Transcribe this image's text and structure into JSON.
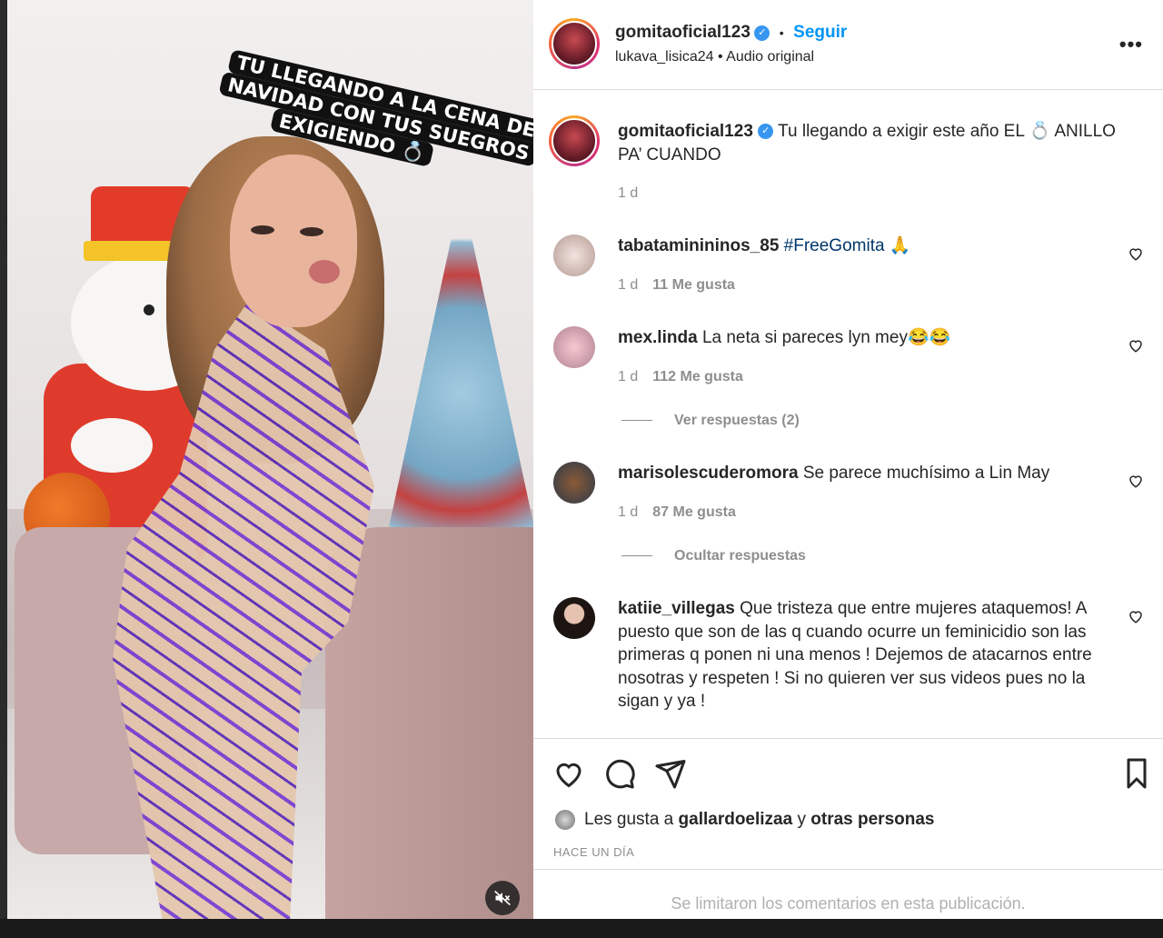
{
  "media": {
    "sticker_lines": [
      "TU LLEGANDO A LA CENA DE",
      "NAVIDAD CON TUS SUEGROS",
      "EXIGIENDO 💍"
    ],
    "mute_icon": "speaker-muted-icon"
  },
  "header": {
    "username": "gomitaoficial123",
    "verified_icon": "verified-badge-icon",
    "separator": "•",
    "follow_label": "Seguir",
    "audio_user": "lukava_lisica24",
    "audio_sep": "•",
    "audio_label": "Audio original",
    "more_label": "•••"
  },
  "caption": {
    "username": "gomitaoficial123",
    "text": "Tu llegando a exigir este año EL 💍 ANILLO PA’ CUANDO",
    "time": "1 d"
  },
  "comments": [
    {
      "username": "tabataminininos_85",
      "text": "#FreeGomita 🙏",
      "time": "1 d",
      "likes": "11 Me gusta"
    },
    {
      "username": "mex.linda",
      "text": "La neta si pareces lyn mey😂😂",
      "time": "1 d",
      "likes": "112 Me gusta",
      "replies": "Ver respuestas (2)"
    },
    {
      "username": "marisolescuderomora",
      "text": "Se parece muchísimo a Lin May",
      "time": "1 d",
      "likes": "87 Me gusta",
      "replies": "Ocultar respuestas"
    },
    {
      "username": "katiie_villegas",
      "text": "Que tristeza que entre mujeres ataquemos! A puesto que son de las q cuando ocurre un feminicidio son las primeras q ponen ni una menos ! Dejemos de atacarnos entre nosotras y respeten ! Si no quieren ver sus videos pues no la sigan y ya !"
    }
  ],
  "actions": {
    "icons": [
      "heart-icon",
      "comment-icon",
      "share-icon",
      "bookmark-icon"
    ],
    "likes_prefix": "Les gusta a",
    "likes_user": "gallardoelizaa",
    "likes_and": "y",
    "likes_others": "otras personas",
    "time_ago": "HACE UN DÍA"
  },
  "footer": {
    "limited_text": "Se limitaron los comentarios en esta publicación."
  },
  "colors": {
    "link_blue": "#0095f6",
    "verified_blue": "#3797f0",
    "text": "#262626",
    "muted": "#8e8e8e"
  }
}
